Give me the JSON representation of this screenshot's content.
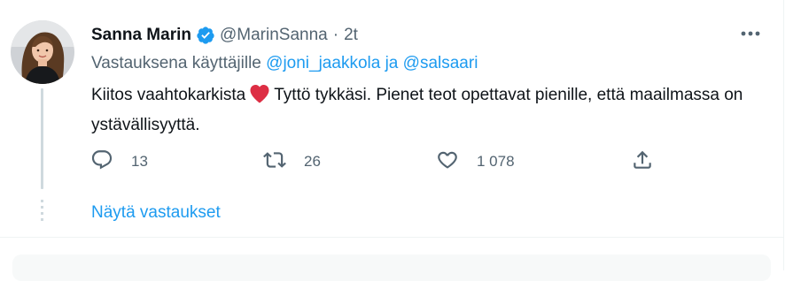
{
  "tweet": {
    "author_name": "Sanna Marin",
    "author_handle": "@MarinSanna",
    "separator": "·",
    "time": "2t",
    "verified_color": "#1d9bf0",
    "replying_prefix": "Vastauksena käyttäjille",
    "mention_1": "@joni_jaakkola",
    "mention_join": "ja",
    "mention_2": "@salsaari",
    "text_part_1": "Kiitos vaahtokarkista",
    "text_part_2": "Tyttö tykkäsi. Pienet teot opettavat pienille, että maailmassa on ystävällisyyttä.",
    "emoji": "red-heart",
    "more_icon": "more-horizontal-icon"
  },
  "actions": {
    "reply_count": "13",
    "retweet_count": "26",
    "like_count": "1 078"
  },
  "show_replies_label": "Näytä vastaukset",
  "colors": {
    "accent": "#1d9bf0",
    "secondary_text": "#536471",
    "heart": "#e0245e",
    "thread_line": "#cfd9de"
  }
}
